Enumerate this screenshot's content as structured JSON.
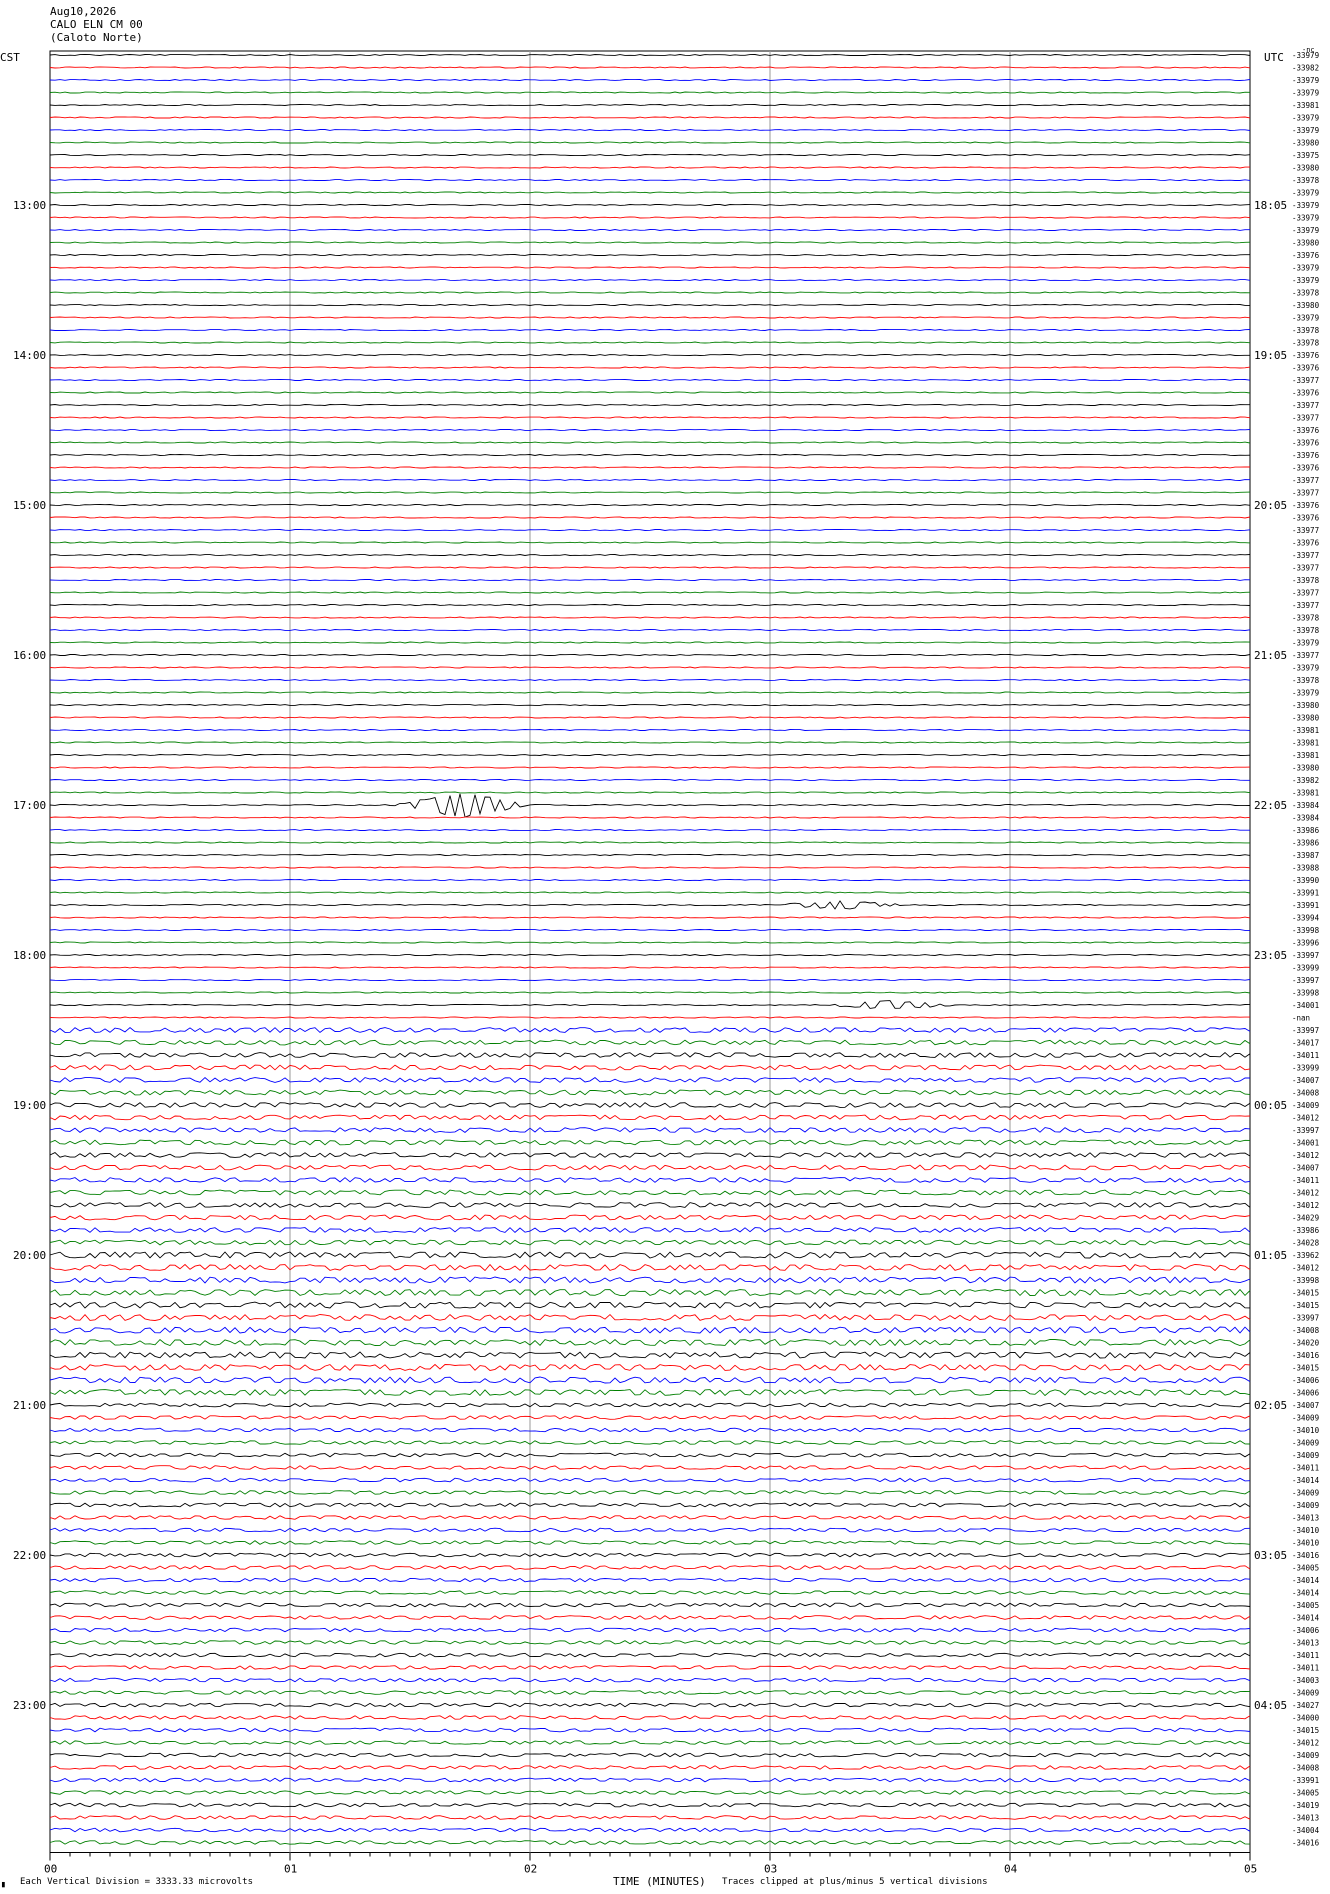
{
  "header": {
    "date": "Aug10,2026",
    "station": "CALO ELN CM 00",
    "location": "(Caloto Norte)"
  },
  "left_timezone": "CST",
  "right_timezone": "UTC",
  "footer": {
    "scale_note": "Each Vertical Division = 3333.33 microvolts",
    "xlabel": "TIME (MINUTES)",
    "clip_note": "Traces clipped at plus/minus 5 vertical divisions"
  },
  "colors": {
    "trace_cycle": [
      "#000000",
      "#ff0000",
      "#0000ff",
      "#007f00"
    ],
    "grid": "#9a9a9a"
  },
  "chart_data": {
    "type": "line",
    "xlabel": "TIME (MINUTES)",
    "x_ticks": [
      "00",
      "01",
      "02",
      "03",
      "04",
      "05"
    ],
    "xlim": [
      0,
      5
    ],
    "row_count": 144,
    "left_hour_labels": [
      "13:00",
      "14:00",
      "15:00",
      "16:00",
      "17:00",
      "18:00",
      "19:00",
      "20:00",
      "21:00",
      "22:00",
      "23:00"
    ],
    "right_hour_labels": [
      "18:05",
      "19:05",
      "20:05",
      "21:05",
      "22:05",
      "23:05",
      "00:05",
      "01:05",
      "02:05",
      "03:05",
      "04:05"
    ],
    "hour_label_rows": [
      12,
      24,
      36,
      48,
      60,
      72,
      84,
      96,
      108,
      120,
      132
    ],
    "right_values": [
      "-33979",
      "-33982",
      "-33979",
      "-33979",
      "-33981",
      "-33979",
      "-33979",
      "-33980",
      "-33975",
      "-33980",
      "-33978",
      "-33979",
      "-33979",
      "-33979",
      "-33979",
      "-33980",
      "-33976",
      "-33979",
      "-33979",
      "-33978",
      "-33980",
      "-33979",
      "-33978",
      "-33978",
      "-33976",
      "-33976",
      "-33977",
      "-33976",
      "-33977",
      "-33977",
      "-33976",
      "-33976",
      "-33976",
      "-33976",
      "-33977",
      "-33977",
      "-33976",
      "-33976",
      "-33977",
      "-33976",
      "-33977",
      "-33977",
      "-33978",
      "-33977",
      "-33977",
      "-33978",
      "-33978",
      "-33979",
      "-33977",
      "-33979",
      "-33978",
      "-33979",
      "-33980",
      "-33980",
      "-33981",
      "-33981",
      "-33981",
      "-33980",
      "-33982",
      "-33981",
      "-33984",
      "-33984",
      "-33986",
      "-33986",
      "-33987",
      "-33988",
      "-33990",
      "-33991",
      "-33991",
      "-33994",
      "-33998",
      "-33996",
      "-33997",
      "-33999",
      "-33997",
      "-33998",
      "-34001",
      "-nan",
      "-33997",
      "-34017",
      "-34011",
      "-33999",
      "-34007",
      "-34008",
      "-34009",
      "-34012",
      "-33997",
      "-34001",
      "-34012",
      "-34007",
      "-34011",
      "-34012",
      "-34012",
      "-34029",
      "-33986",
      "-34028",
      "-33962",
      "-34012",
      "-33998",
      "-34015",
      "-34015",
      "-33997",
      "-34008",
      "-34020",
      "-34016",
      "-34015",
      "-34006",
      "-34006",
      "-34007",
      "-34009",
      "-34010",
      "-34009",
      "-34009",
      "-34011",
      "-34014",
      "-34009",
      "-34009",
      "-34013",
      "-34010",
      "-34010",
      "-34016",
      "-34005",
      "-34014",
      "-34014",
      "-34005",
      "-34014",
      "-34006",
      "-34013",
      "-34011",
      "-34011",
      "-34003",
      "-34009",
      "-34027",
      "-34000",
      "-34015",
      "-34012",
      "-34009",
      "-34008",
      "-33991",
      "-34005",
      "-34019",
      "-34013",
      "-34004",
      "-34016"
    ],
    "top_right_marker": "-nc",
    "events": [
      {
        "row": 60,
        "minute": 1.72,
        "note": "large spike"
      },
      {
        "row": 68,
        "minute": 3.3,
        "note": "burst"
      },
      {
        "row": 76,
        "minute": 3.5,
        "note": "burst"
      }
    ]
  }
}
